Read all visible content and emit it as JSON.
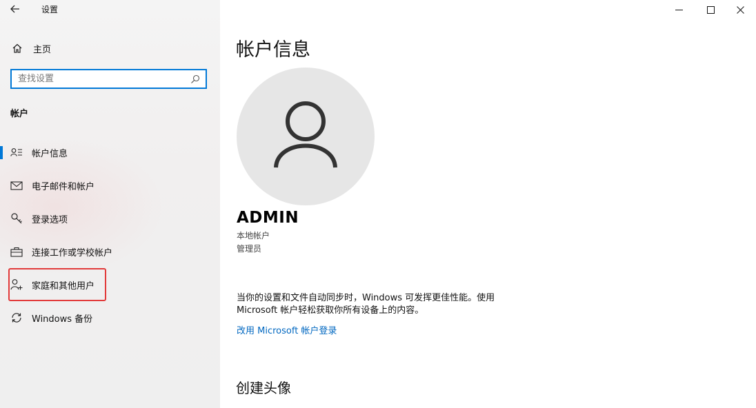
{
  "window": {
    "title": "设置",
    "back_icon": "back-arrow-icon",
    "controls": [
      "minimize-icon",
      "maximize-icon",
      "close-icon"
    ]
  },
  "sidebar": {
    "home_label": "主页",
    "home_icon": "home-icon",
    "search_placeholder": "查找设置",
    "search_icon": "search-icon",
    "section_title": "帐户",
    "items": [
      {
        "label": "帐户信息",
        "icon": "account-info-icon",
        "active": true
      },
      {
        "label": "电子邮件和帐户",
        "icon": "mail-icon",
        "active": false
      },
      {
        "label": "登录选项",
        "icon": "key-icon",
        "active": false
      },
      {
        "label": "连接工作或学校帐户",
        "icon": "briefcase-icon",
        "active": false
      },
      {
        "label": "家庭和其他用户",
        "icon": "add-person-icon",
        "active": false,
        "highlighted": true
      },
      {
        "label": "Windows 备份",
        "icon": "sync-icon",
        "active": false
      }
    ]
  },
  "main": {
    "title": "帐户信息",
    "avatar_icon": "user-avatar-icon",
    "user_name": "ADMIN",
    "account_type": "本地帐户",
    "account_role": "管理员",
    "sync_text": "当你的设置和文件自动同步时，Windows 可发挥更佳性能。使用 Microsoft 帐户轻松获取你所有设备上的内容。",
    "ms_link": "改用 Microsoft 帐户登录",
    "avatar_section_title": "创建头像"
  },
  "colors": {
    "accent": "#0078d7",
    "link": "#0067c0",
    "highlight": "#e23a3a",
    "avatar_bg": "#e6e6e6"
  }
}
